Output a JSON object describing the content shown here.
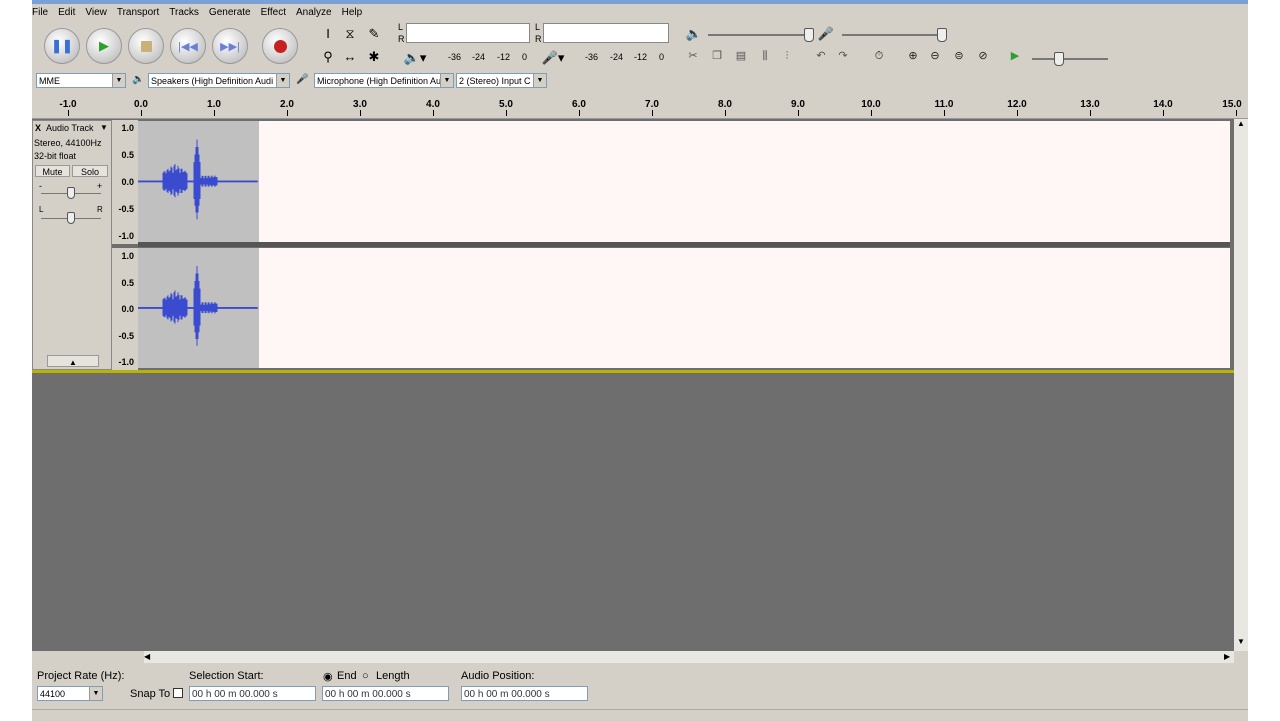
{
  "menu": [
    "File",
    "Edit",
    "View",
    "Transport",
    "Tracks",
    "Generate",
    "Effect",
    "Analyze",
    "Help"
  ],
  "transport": {
    "pause": "pause-icon",
    "play": "play-icon",
    "stop": "stop-icon",
    "skip_start": "skip-start-icon",
    "skip_end": "skip-end-icon",
    "record": "record-icon"
  },
  "meters": {
    "playback": {
      "left": "L",
      "right": "R",
      "scale": [
        "-36",
        "-24",
        "-12",
        "0"
      ]
    },
    "record": {
      "left": "L",
      "right": "R",
      "scale": [
        "-36",
        "-24",
        "-12",
        "0"
      ]
    }
  },
  "devices": {
    "host": "MME",
    "output": "Speakers (High Definition Audi",
    "input": "Microphone (High Definition Au",
    "channels": "2 (Stereo) Input C"
  },
  "ruler_labels": [
    "-1.0",
    "0.0",
    "1.0",
    "2.0",
    "3.0",
    "4.0",
    "5.0",
    "6.0",
    "7.0",
    "8.0",
    "9.0",
    "10.0",
    "11.0",
    "12.0",
    "13.0",
    "14.0",
    "15.0"
  ],
  "track": {
    "close": "X",
    "name": "Audio Track",
    "info1": "Stereo, 44100Hz",
    "info2": "32-bit float",
    "mute": "Mute",
    "solo": "Solo",
    "gain_minus": "-",
    "gain_plus": "+",
    "pan_left": "L",
    "pan_right": "R",
    "amp_labels": [
      "1.0",
      "0.5",
      "0.0",
      "-0.5",
      "-1.0"
    ]
  },
  "selection_toolbar": {
    "project_rate_label": "Project Rate (Hz):",
    "project_rate": "44100",
    "snap_to": "Snap To",
    "selection_start_label": "Selection Start:",
    "end_label": "End",
    "length_label": "Length",
    "audio_position_label": "Audio Position:",
    "start_value": "00 h 00 m 00.000 s",
    "end_value": "00 h 00 m 00.000 s",
    "position_value": "00 h 00 m 00.000 s"
  },
  "colors": {
    "waveform": "#3a4bd0",
    "selection": "#c0c0c0",
    "track_bg": "#fff7f5",
    "workspace": "#6e6e6e"
  }
}
